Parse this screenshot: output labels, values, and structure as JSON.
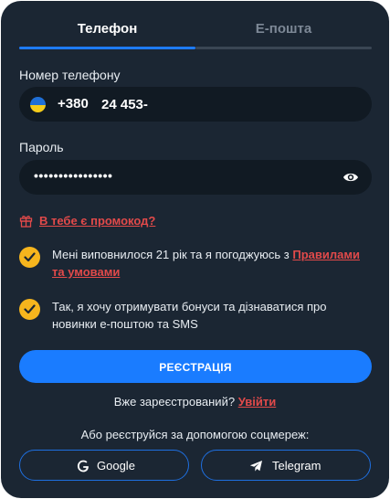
{
  "tabs": [
    {
      "label": "Телефон",
      "active": true
    },
    {
      "label": "E-пошта",
      "active": false
    }
  ],
  "phone": {
    "label": "Номер телефону",
    "country_prefix": "+380",
    "value": "24 453-"
  },
  "password": {
    "label": "Пароль",
    "masked_value": "••••••••••••••••"
  },
  "promo": {
    "label": "В тебе є промокод?"
  },
  "consents": [
    {
      "text": "Мені виповнилося 21 рік та я погоджуюсь з ",
      "link": "Правилами та умовами",
      "checked": true
    },
    {
      "text": "Так, я хочу отримувати бонуси та дізнаватися про новинки е-поштою та SMS",
      "checked": true
    }
  ],
  "register_button": "РЕЄСТРАЦІЯ",
  "login": {
    "prompt": "Вже зареєстрований?",
    "link": "Увійти"
  },
  "social": {
    "prompt": "Або реєструйся за допомогою соцмереж:",
    "google": "Google",
    "telegram": "Telegram"
  },
  "colors": {
    "panel": "#1b2633",
    "accent": "#1a7cff",
    "link": "#e24a4a",
    "check": "#f6b51d"
  },
  "icons": [
    "ukraine-flag-icon",
    "eye-icon",
    "gift-icon",
    "check-icon",
    "google-icon",
    "telegram-icon"
  ]
}
